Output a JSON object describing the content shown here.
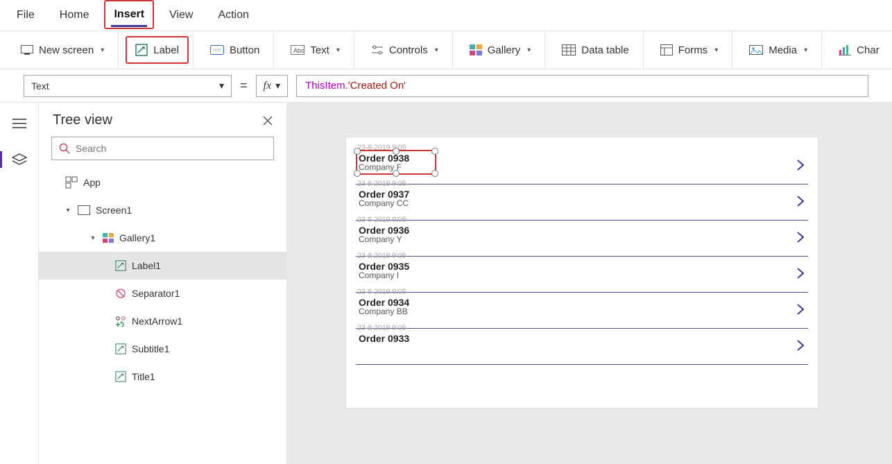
{
  "menu": {
    "file": "File",
    "home": "Home",
    "insert": "Insert",
    "view": "View",
    "action": "Action",
    "active": "insert"
  },
  "ribbon": {
    "new_screen": "New screen",
    "label": "Label",
    "button": "Button",
    "text": "Text",
    "controls": "Controls",
    "gallery": "Gallery",
    "data_table": "Data table",
    "forms": "Forms",
    "media": "Media",
    "charts": "Char"
  },
  "property_bar": {
    "property": "Text",
    "formula_ident": "ThisItem",
    "formula_tail": ".'Created On'"
  },
  "tree": {
    "title": "Tree view",
    "search_placeholder": "Search",
    "app": "App",
    "screen": "Screen1",
    "gallery": "Gallery1",
    "items": {
      "label1": "Label1",
      "separator1": "Separator1",
      "nextarrow1": "NextArrow1",
      "subtitle1": "Subtitle1",
      "title1": "Title1"
    }
  },
  "gallery_data": [
    {
      "title": "Order 0938",
      "subtitle": "Company F",
      "date": "23-8-2019 9:05"
    },
    {
      "title": "Order 0937",
      "subtitle": "Company CC",
      "date": "23-8-2019 9:05"
    },
    {
      "title": "Order 0936",
      "subtitle": "Company Y",
      "date": "23-8-2019 9:05"
    },
    {
      "title": "Order 0935",
      "subtitle": "Company I",
      "date": "23-8-2019 9:05"
    },
    {
      "title": "Order 0934",
      "subtitle": "Company BB",
      "date": "23-8-2019 9:05"
    },
    {
      "title": "Order 0933",
      "subtitle": "",
      "date": "23-8-2019 9:05"
    }
  ]
}
